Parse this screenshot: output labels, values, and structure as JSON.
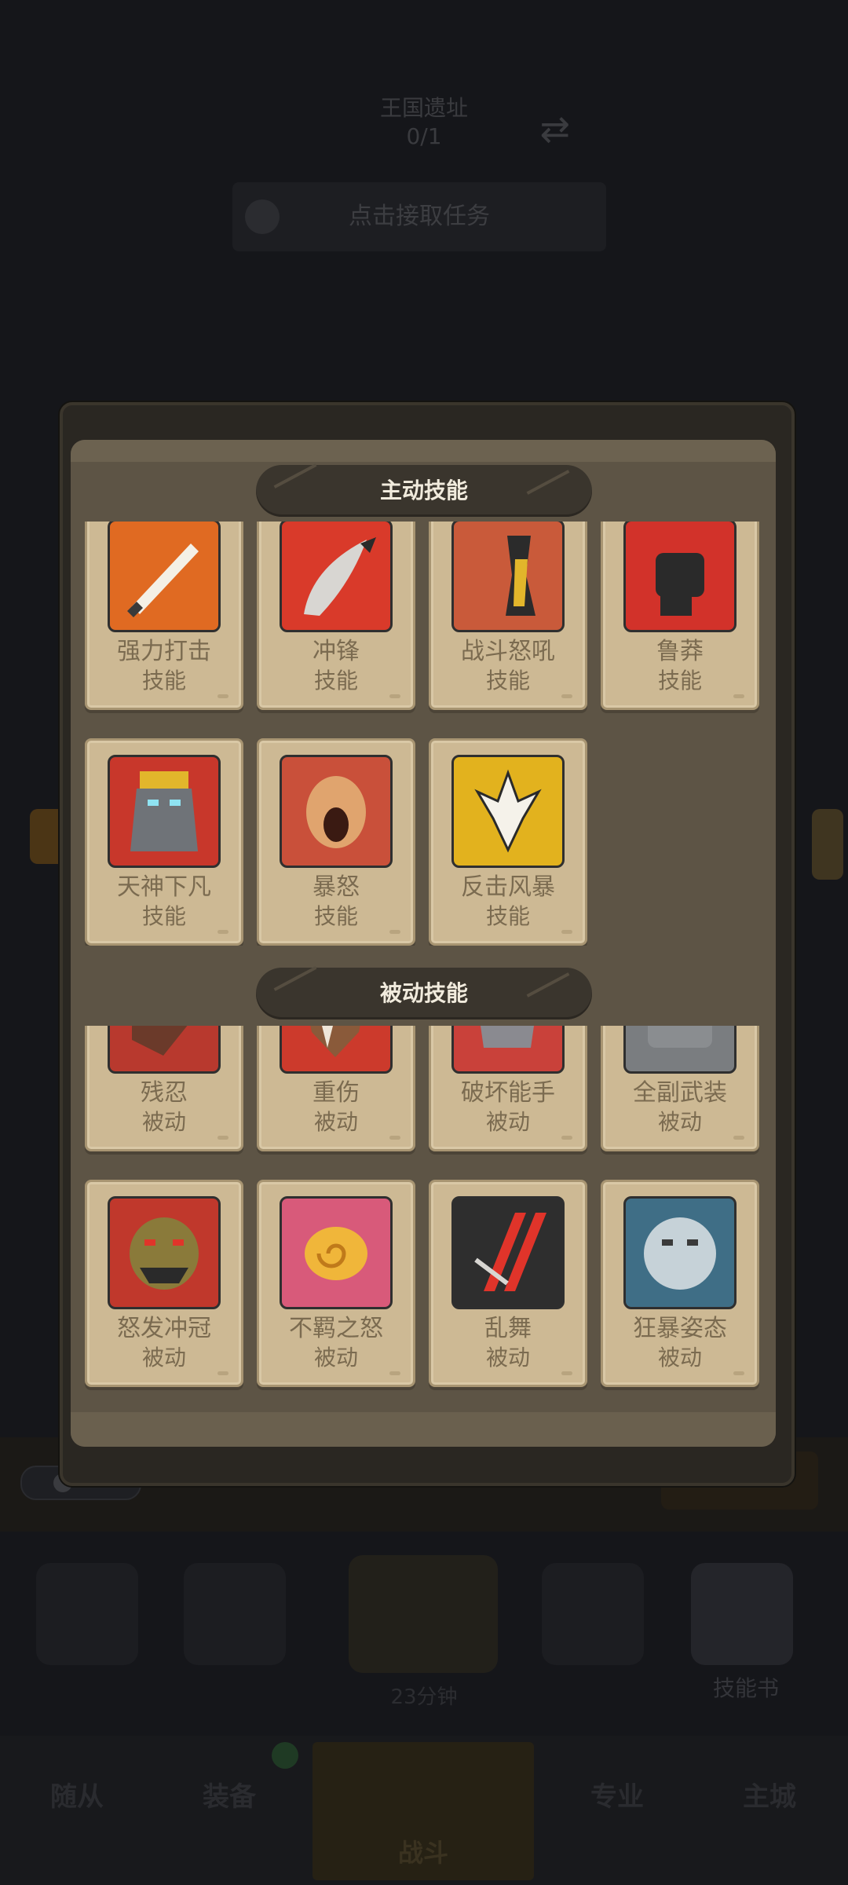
{
  "background": {
    "quest": {
      "title": "王国遗址",
      "count": "0/1",
      "button_label": "点击接取任务"
    },
    "timer": "23分钟",
    "skill_book_label": "技能书",
    "nav": [
      "随从",
      "装备",
      "战斗",
      "专业",
      "主城"
    ]
  },
  "modal": {
    "active_section": {
      "title": "主动技能",
      "skills": [
        {
          "name": "强力打击",
          "type": "技能",
          "icon": "sword-strike-icon",
          "color": "#e06a22"
        },
        {
          "name": "冲锋",
          "type": "技能",
          "icon": "charge-blade-icon",
          "color": "#d93a2a"
        },
        {
          "name": "战斗怒吼",
          "type": "技能",
          "icon": "battle-shout-icon",
          "color": "#c95a3a"
        },
        {
          "name": "鲁莽",
          "type": "技能",
          "icon": "fist-icon",
          "color": "#d2322a"
        },
        {
          "name": "天神下凡",
          "type": "技能",
          "icon": "avatar-king-icon",
          "color": "#c8372b"
        },
        {
          "name": "暴怒",
          "type": "技能",
          "icon": "enrage-face-icon",
          "color": "#c9503a"
        },
        {
          "name": "反击风暴",
          "type": "技能",
          "icon": "retaliation-icon",
          "color": "#e2b21e"
        }
      ]
    },
    "passive_section": {
      "title": "被动技能",
      "skills": [
        {
          "name": "残忍",
          "type": "被动",
          "icon": "cruelty-icon",
          "color": "#b8392e"
        },
        {
          "name": "重伤",
          "type": "被动",
          "icon": "deep-wound-icon",
          "color": "#cc3a2c"
        },
        {
          "name": "破坏能手",
          "type": "被动",
          "icon": "destroyer-icon",
          "color": "#c9413a"
        },
        {
          "name": "全副武装",
          "type": "被动",
          "icon": "armor-helmet-icon",
          "color": "#7a7d80"
        },
        {
          "name": "怒发冲冠",
          "type": "被动",
          "icon": "orc-face-icon",
          "color": "#c0382c"
        },
        {
          "name": "不羁之怒",
          "type": "被动",
          "icon": "spiral-rage-icon",
          "color": "#d85a7a"
        },
        {
          "name": "乱舞",
          "type": "被动",
          "icon": "claw-slash-icon",
          "color": "#2e2e2e"
        },
        {
          "name": "狂暴姿态",
          "type": "被动",
          "icon": "berserker-beast-icon",
          "color": "#3f6e86"
        }
      ]
    }
  }
}
